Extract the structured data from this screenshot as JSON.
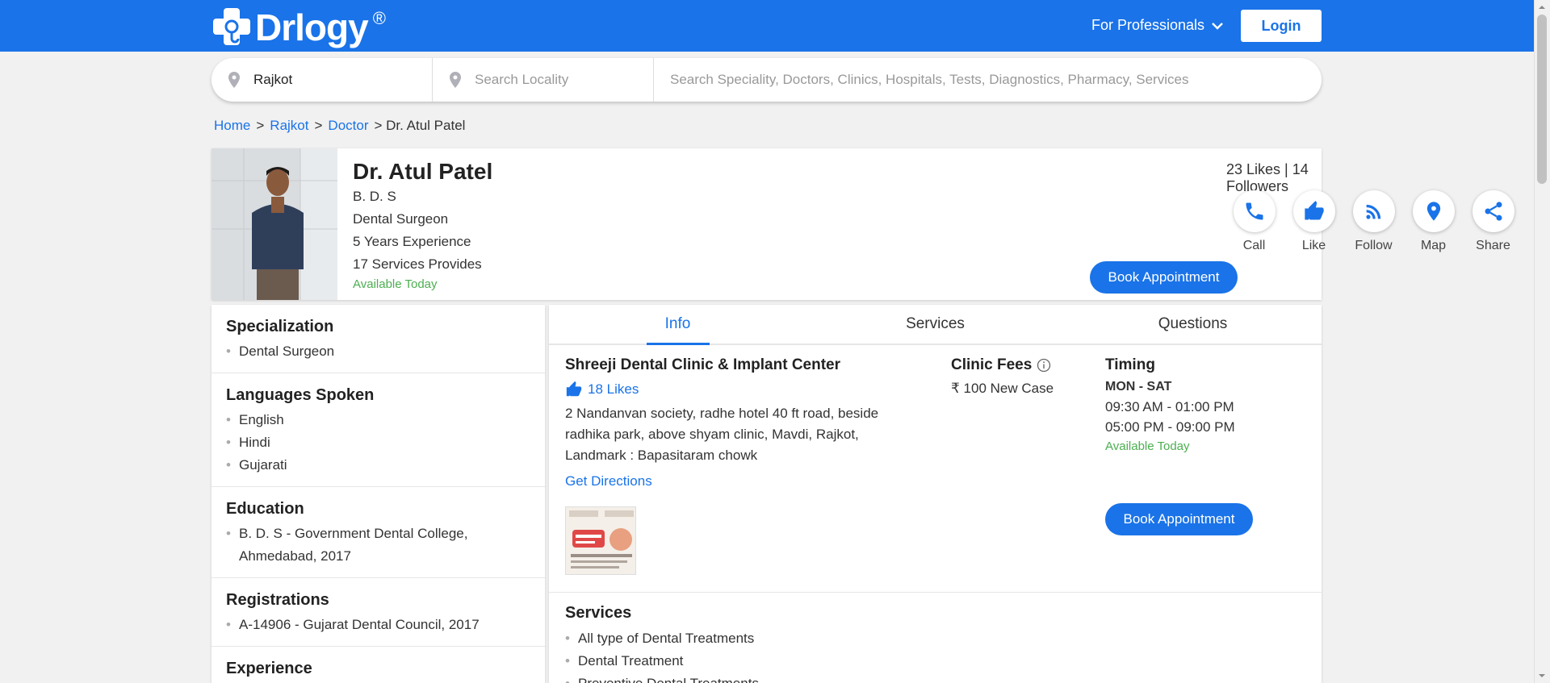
{
  "header": {
    "logo_text": "Drlogy",
    "logo_reg": "®",
    "for_professionals": "For Professionals",
    "login": "Login",
    "brand_color": "#1a73e8"
  },
  "search": {
    "city_value": "Rajkot",
    "locality_placeholder": "Search Locality",
    "main_placeholder": "Search Speciality, Doctors, Clinics, Hospitals, Tests, Diagnostics, Pharmacy, Services"
  },
  "breadcrumb": {
    "home": "Home",
    "sep1": ">",
    "city": "Rajkot",
    "sep2": ">",
    "category": "Doctor",
    "current": "> Dr. Atul Patel"
  },
  "profile": {
    "name": "Dr. Atul Patel",
    "degree": "B. D. S",
    "title": "Dental Surgeon",
    "experience": "5 Years Experience",
    "services_count": "17 Services Provides",
    "availability": "Available Today",
    "likes_followers": "23 Likes | 14 Followers",
    "actions": [
      {
        "label": "Call",
        "icon": "phone-icon"
      },
      {
        "label": "Like",
        "icon": "thumbs-up-icon"
      },
      {
        "label": "Follow",
        "icon": "rss-icon"
      },
      {
        "label": "Map",
        "icon": "map-pin-icon"
      },
      {
        "label": "Share",
        "icon": "share-icon"
      }
    ],
    "book_label": "Book Appointment"
  },
  "left": {
    "specialization": {
      "title": "Specialization",
      "items": [
        "Dental Surgeon"
      ]
    },
    "languages": {
      "title": "Languages Spoken",
      "items": [
        "English",
        "Hindi",
        "Gujarati"
      ]
    },
    "education": {
      "title": "Education",
      "items": [
        "B. D. S - Government Dental College, Ahmedabad, 2017"
      ]
    },
    "registrations": {
      "title": "Registrations",
      "items": [
        "A-14906 - Gujarat Dental Council, 2017"
      ]
    },
    "experience": {
      "title": "Experience"
    }
  },
  "tabs": [
    "Info",
    "Services",
    "Questions"
  ],
  "clinic": {
    "name": "Shreeji Dental Clinic & Implant Center",
    "likes": "18 Likes",
    "address": "2 Nandanvan society, radhe hotel 40 ft road, beside radhika park, above shyam clinic, Mavdi, Rajkot, Landmark : Bapasitaram chowk",
    "directions": "Get Directions",
    "fees_title": "Clinic Fees",
    "fees_value": "₹ 100 New Case",
    "timing_title": "Timing",
    "timing_days": "MON - SAT",
    "timing_slot1": "09:30 AM - 01:00 PM",
    "timing_slot2": "05:00 PM - 09:00 PM",
    "availability": "Available Today",
    "book_label": "Book Appointment"
  },
  "services": {
    "title": "Services",
    "items": [
      "All type of Dental Treatments",
      "Dental Treatment",
      "Preventive Dental Treatments"
    ]
  }
}
